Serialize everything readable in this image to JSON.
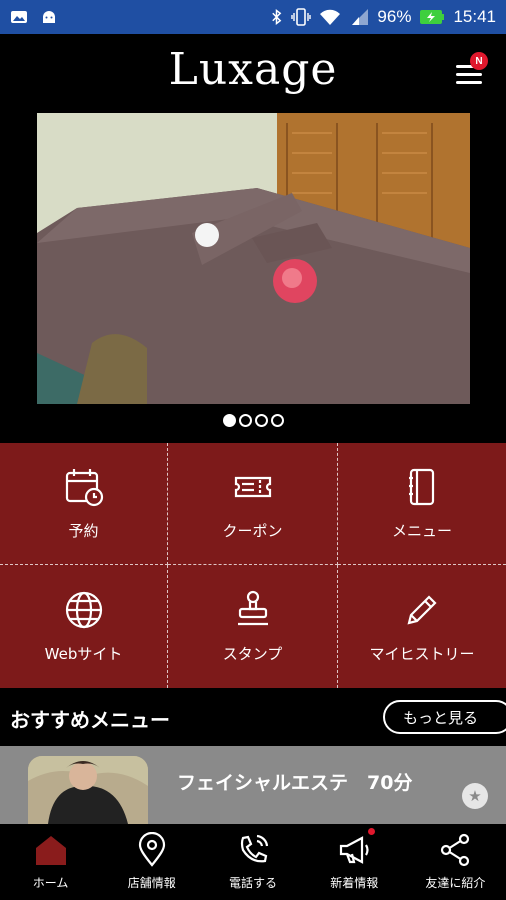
{
  "status_bar": {
    "battery": "96%",
    "time": "15:41"
  },
  "header": {
    "title": "Luxage",
    "menu_badge": "N"
  },
  "slider": {
    "slide_count": 4,
    "active_index": 0
  },
  "grid": [
    {
      "label": "予約",
      "icon": "calendar-clock-icon"
    },
    {
      "label": "クーポン",
      "icon": "coupon-icon"
    },
    {
      "label": "メニュー",
      "icon": "menu-book-icon"
    },
    {
      "label": "Webサイト",
      "icon": "globe-icon"
    },
    {
      "label": "スタンプ",
      "icon": "stamp-icon"
    },
    {
      "label": "マイヒストリー",
      "icon": "pencil-icon"
    }
  ],
  "recommended": {
    "title": "おすすめメニュー",
    "more_label": "もっと見る",
    "items": [
      {
        "name": "フェイシャルエステ　70分"
      }
    ]
  },
  "tabbar": [
    {
      "label": "ホーム",
      "icon": "home-icon"
    },
    {
      "label": "店舗情報",
      "icon": "map-pin-icon"
    },
    {
      "label": "電話する",
      "icon": "phone-icon"
    },
    {
      "label": "新着情報",
      "icon": "megaphone-icon"
    },
    {
      "label": "友達に紹介",
      "icon": "share-icon"
    }
  ],
  "colors": {
    "status_bar": "#1f4fa3",
    "accent_red": "#7d1a1a",
    "home_active": "#8a1c1c",
    "badge": "#e0182d"
  }
}
